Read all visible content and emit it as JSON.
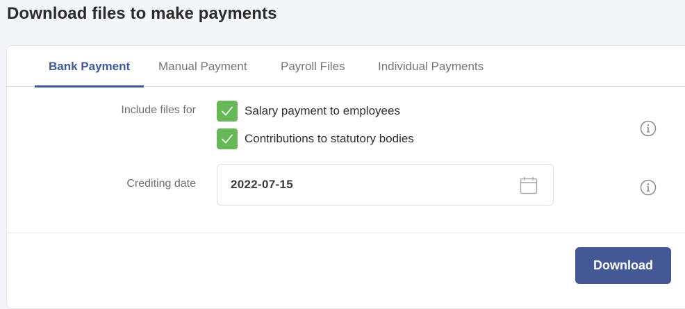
{
  "page": {
    "title": "Download files to make payments"
  },
  "tabs": [
    {
      "label": "Bank Payment",
      "active": true
    },
    {
      "label": "Manual Payment",
      "active": false
    },
    {
      "label": "Payroll Files",
      "active": false
    },
    {
      "label": "Individual Payments",
      "active": false
    }
  ],
  "form": {
    "include_files": {
      "label": "Include files for",
      "options": [
        {
          "label": "Salary payment to employees",
          "checked": true
        },
        {
          "label": "Contributions to statutory bodies",
          "checked": true
        }
      ]
    },
    "crediting_date": {
      "label": "Crediting date",
      "value": "2022-07-15"
    }
  },
  "actions": {
    "download_label": "Download"
  },
  "icons": {
    "info": "info-icon",
    "calendar": "calendar-icon",
    "check": "checkmark-icon"
  },
  "colors": {
    "accent": "#3c5a99",
    "button": "#435895",
    "checkbox": "#67b858"
  }
}
